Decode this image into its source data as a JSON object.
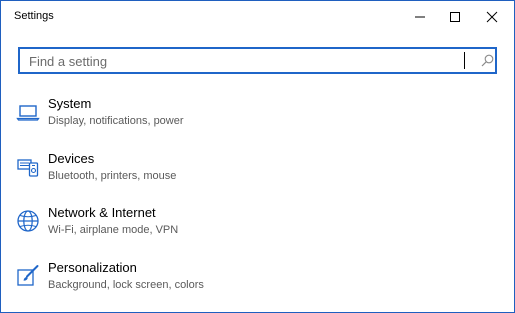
{
  "window": {
    "title": "Settings",
    "controls": {
      "minimize": "minimize-icon",
      "maximize": "maximize-icon",
      "close": "close-icon"
    }
  },
  "search": {
    "placeholder": "Find a setting",
    "value": "",
    "icon": "search-icon"
  },
  "accent_color": "#1f66c9",
  "categories": [
    {
      "label": "System",
      "description": "Display, notifications, power",
      "icon": "laptop-icon"
    },
    {
      "label": "Devices",
      "description": "Bluetooth, printers, mouse",
      "icon": "devices-icon"
    },
    {
      "label": "Network & Internet",
      "description": "Wi-Fi, airplane mode, VPN",
      "icon": "globe-icon"
    },
    {
      "label": "Personalization",
      "description": "Background, lock screen, colors",
      "icon": "paintbrush-icon"
    }
  ]
}
